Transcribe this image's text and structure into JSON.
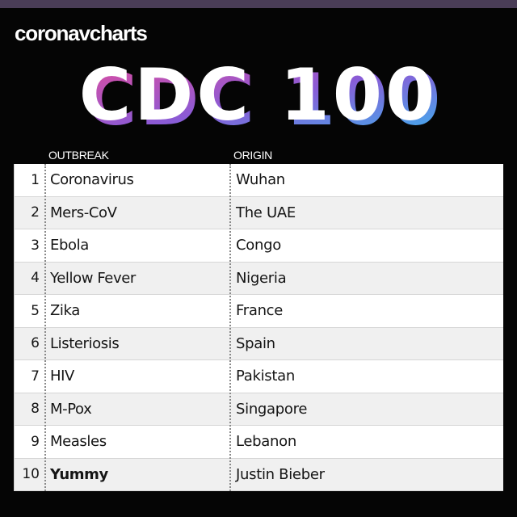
{
  "brand": {
    "name": "coronavcharts"
  },
  "logo": {
    "text": "CDC 100"
  },
  "colors": {
    "background": "#050505",
    "logo_gradient": [
      "#e24b9c",
      "#8a5bd6",
      "#37b7f0"
    ],
    "alt_row": "#f0f0f0"
  },
  "table": {
    "headers": {
      "outbreak": "OUTBREAK",
      "origin": "ORIGIN"
    },
    "rows": [
      {
        "rank": "1",
        "outbreak": "Coronavirus",
        "origin": "Wuhan"
      },
      {
        "rank": "2",
        "outbreak": "Mers-CoV",
        "origin": "The UAE"
      },
      {
        "rank": "3",
        "outbreak": "Ebola",
        "origin": "Congo"
      },
      {
        "rank": "4",
        "outbreak": "Yellow Fever",
        "origin": "Nigeria"
      },
      {
        "rank": "5",
        "outbreak": "Zika",
        "origin": "France"
      },
      {
        "rank": "6",
        "outbreak": "Listeriosis",
        "origin": "Spain"
      },
      {
        "rank": "7",
        "outbreak": "HIV",
        "origin": "Pakistan"
      },
      {
        "rank": "8",
        "outbreak": "M-Pox",
        "origin": "Singapore"
      },
      {
        "rank": "9",
        "outbreak": "Measles",
        "origin": "Lebanon"
      },
      {
        "rank": "10",
        "outbreak": "Yummy",
        "origin": "Justin Bieber"
      }
    ]
  }
}
